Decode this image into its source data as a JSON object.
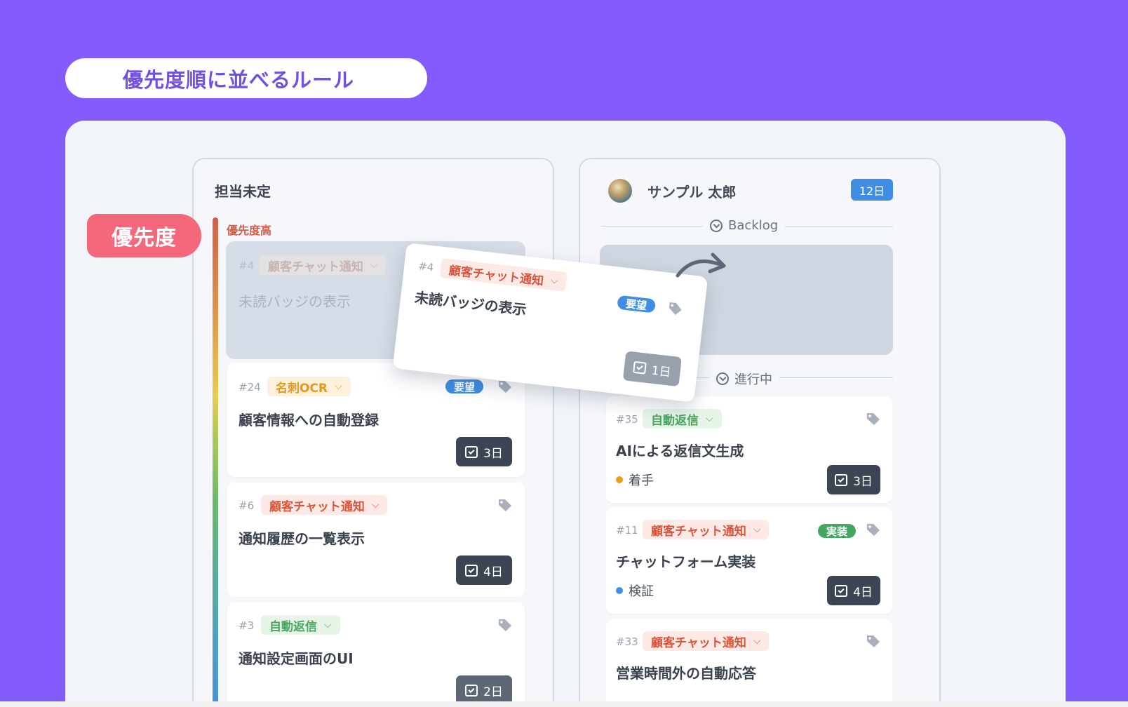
{
  "rule_title": "優先度順に並べるルール",
  "priority_badge": "優先度",
  "columns": {
    "unassigned": {
      "title": "担当未定",
      "priority_high": "優先度高",
      "ghost_card": {
        "num": "#4",
        "tag": "顧客チャット通知",
        "title": "未読バッジの表示"
      },
      "cards": [
        {
          "num": "#24",
          "tag": "名刺OCR",
          "title": "顧客情報への自動登録",
          "label": "要望",
          "days": "3日"
        },
        {
          "num": "#6",
          "tag": "顧客チャット通知",
          "title": "通知履歴の一覧表示",
          "days": "4日"
        },
        {
          "num": "#3",
          "tag": "自動返信",
          "title": "通知設定画面のUI",
          "days": "2日"
        }
      ]
    },
    "user": {
      "name": "サンプル 太郎",
      "days": "12日",
      "sections": {
        "backlog": "Backlog",
        "in_progress": "進行中"
      },
      "cards": [
        {
          "num": "#35",
          "tag": "自動返信",
          "title": "AIによる返信文生成",
          "status": "着手",
          "days": "3日"
        },
        {
          "num": "#11",
          "tag": "顧客チャット通知",
          "title": "チャットフォーム実装",
          "label": "実装",
          "status": "検証",
          "days": "4日"
        },
        {
          "num": "#33",
          "tag": "顧客チャット通知",
          "title": "営業時間外の自動応答"
        }
      ]
    }
  },
  "drag_card": {
    "num": "#4",
    "tag": "顧客チャット通知",
    "title": "未読バッジの表示",
    "label": "要望",
    "days": "1日"
  },
  "colors": {
    "background": "#835cfb",
    "priority_badge": "#f4687b",
    "tag_red": "#d8553b",
    "tag_orange": "#e29a20",
    "tag_green": "#4aa560",
    "label_blue": "#3f8ee3",
    "label_green": "#46a661",
    "status_orange": "#e6a117",
    "status_blue": "#3f8ee3"
  },
  "icons": [
    "tag-icon",
    "calendar-check-icon",
    "chevron-down-icon",
    "arrow-circle-down-icon",
    "curved-arrow-icon",
    "avatar"
  ]
}
